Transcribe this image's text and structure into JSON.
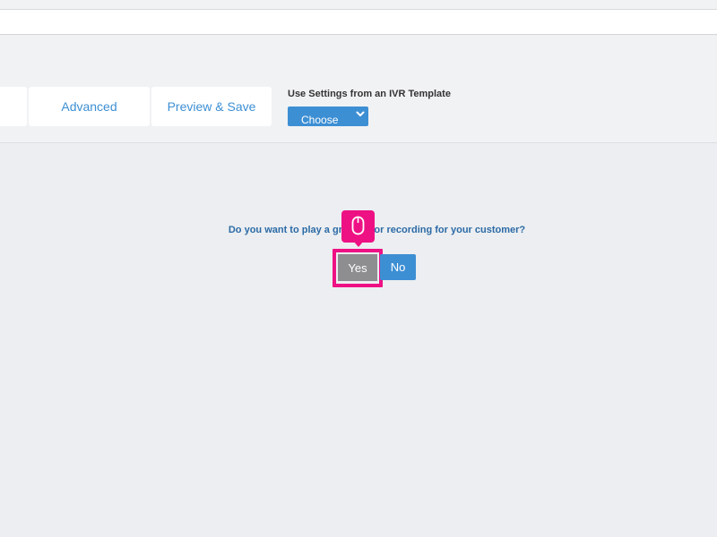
{
  "tabs": [
    {
      "label": ""
    },
    {
      "label": "Advanced"
    },
    {
      "label": "Preview & Save"
    }
  ],
  "template": {
    "label": "Use Settings from an IVR Template",
    "select_value": "Choose"
  },
  "prompt": {
    "question": "Do you want to play a greeting or recording for your customer?",
    "yes_label": "Yes",
    "no_label": "No"
  },
  "colors": {
    "accent": "#3d8fd4",
    "highlight": "#ee1184",
    "question_text": "#2b6aa6",
    "yes_button": "#8e8e91"
  },
  "icons": {
    "click_indicator": "mouse-icon",
    "select_arrow": "chevron-down-icon"
  }
}
